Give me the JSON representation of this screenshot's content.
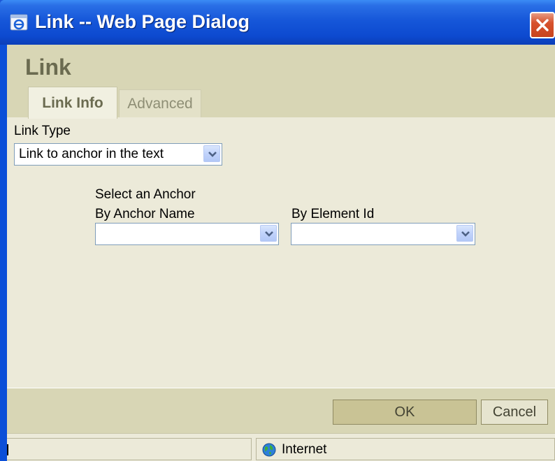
{
  "window": {
    "title": "Link -- Web Page Dialog"
  },
  "dialog": {
    "heading": "Link",
    "tabs": [
      {
        "label": "Link Info",
        "active": true
      },
      {
        "label": "Advanced",
        "active": false
      }
    ],
    "link_type": {
      "label": "Link Type",
      "value": "Link to anchor in the text"
    },
    "anchor": {
      "section_label": "Select an Anchor",
      "by_name_label": "By Anchor Name",
      "by_name_value": "",
      "by_id_label": "By Element Id",
      "by_id_value": ""
    },
    "buttons": {
      "ok": "OK",
      "cancel": "Cancel"
    }
  },
  "statusbar": {
    "zone": "Internet"
  },
  "icons": {
    "title": "ie-page-icon",
    "close": "close-icon",
    "dropdown": "chevron-down-icon",
    "zone": "globe-icon"
  },
  "colors": {
    "titlebar": "#0d4ad0",
    "close": "#d7522d",
    "client": "#ecead9",
    "band": "#d8d6b5",
    "heading": "#6b6b50"
  }
}
